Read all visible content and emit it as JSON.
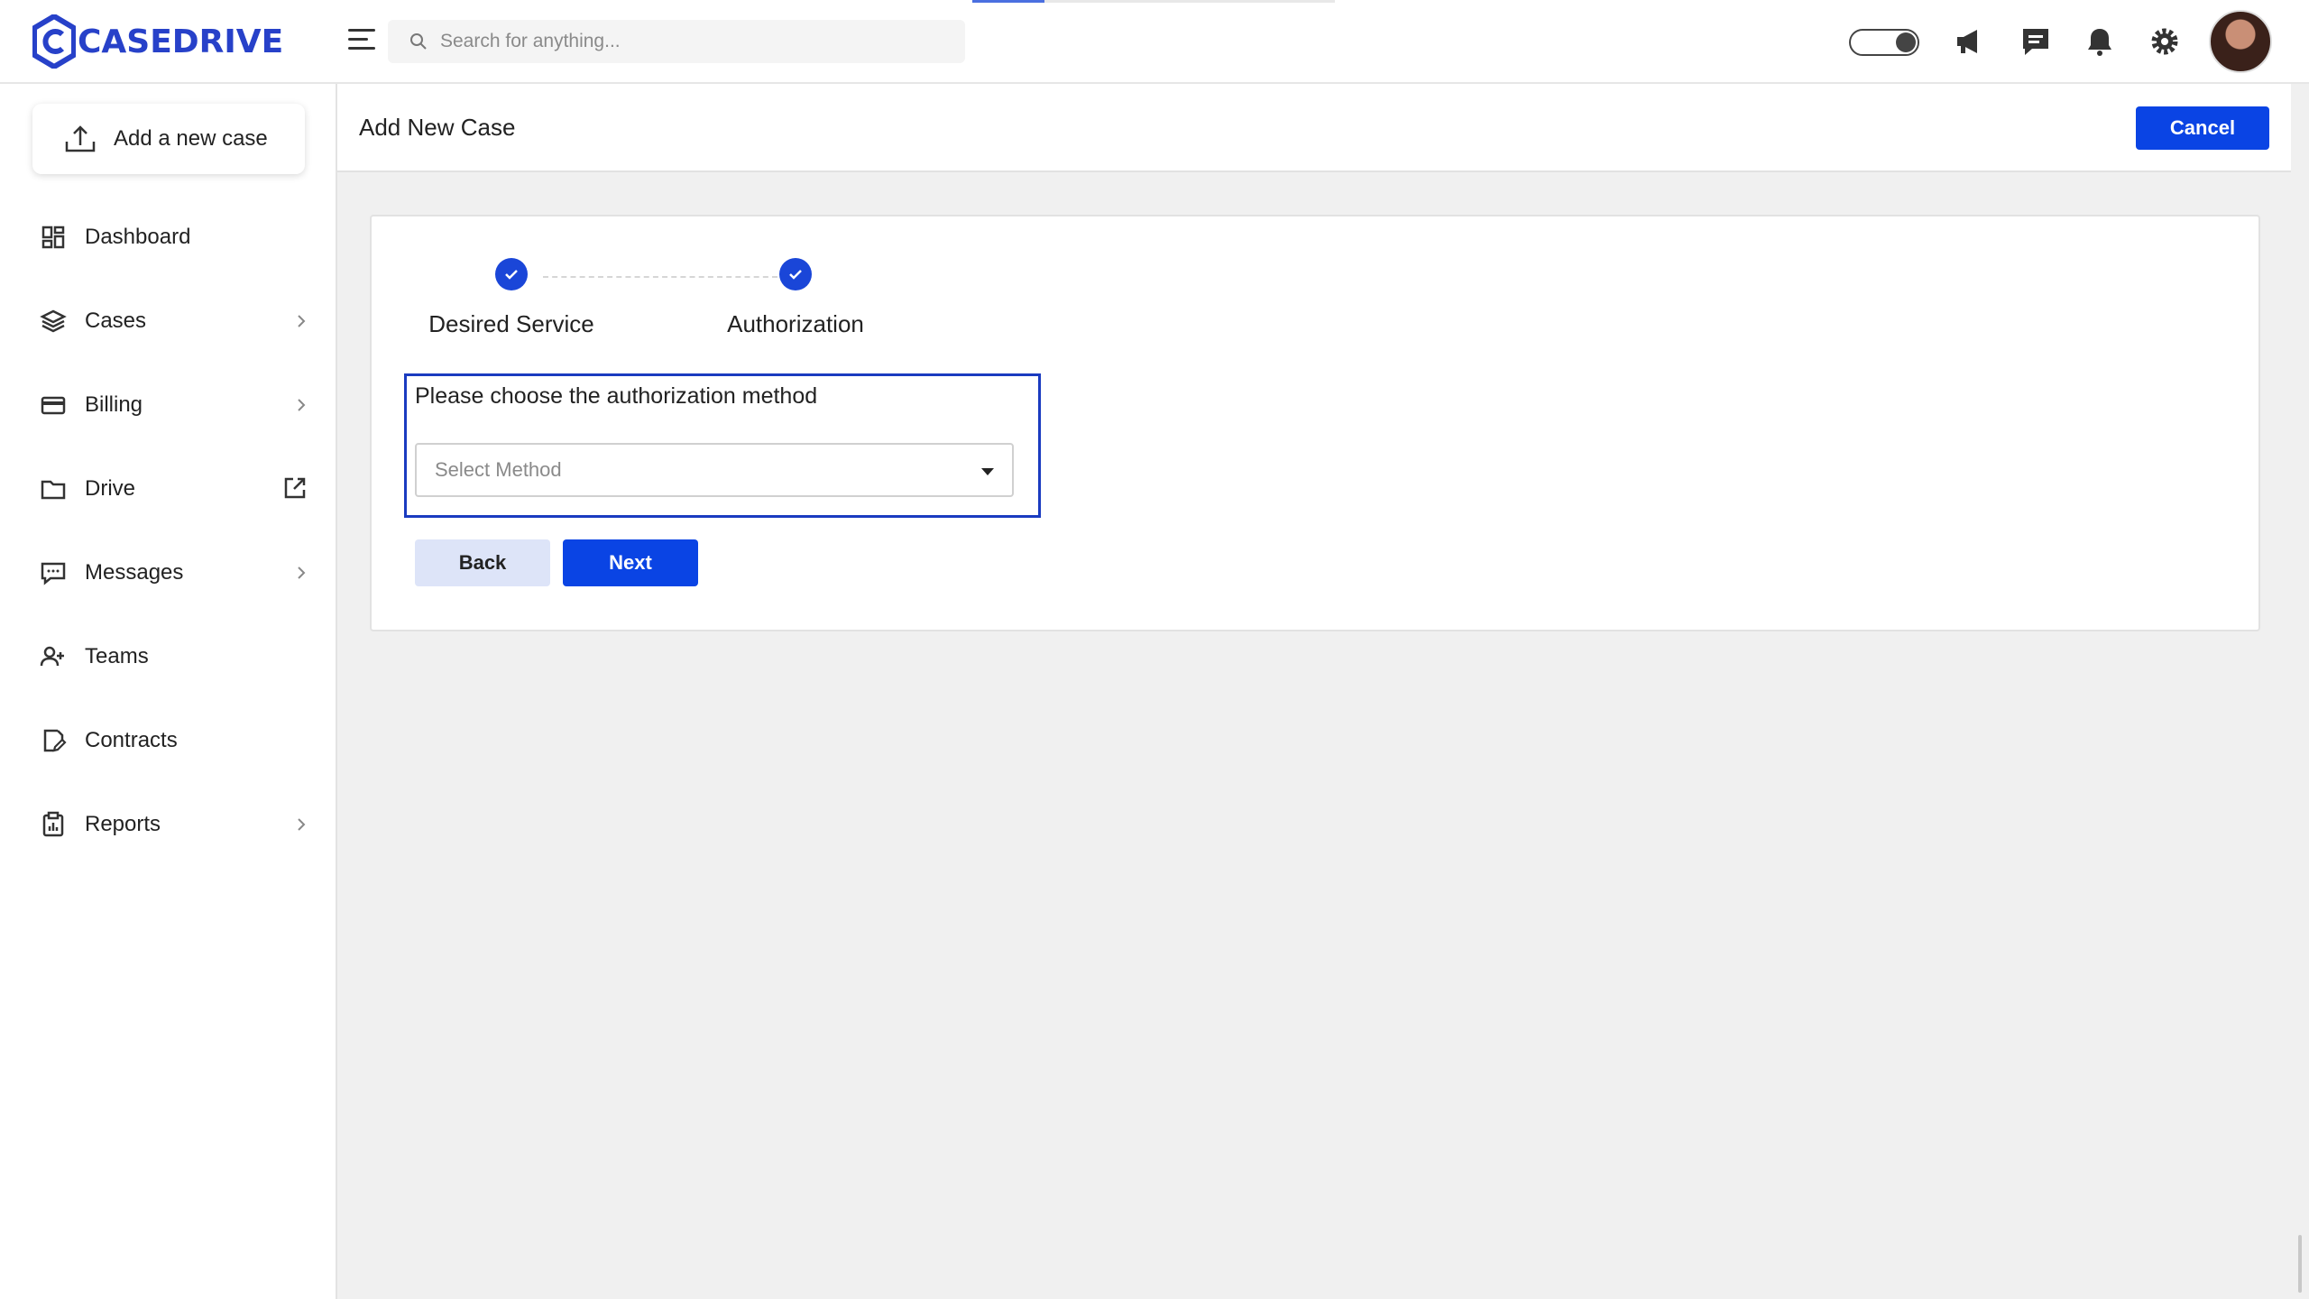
{
  "app": {
    "brand": "CASEDRIVE"
  },
  "header": {
    "search_placeholder": "Search for anything...",
    "icons": [
      "menu-icon",
      "search-icon",
      "theme-toggle",
      "megaphone-icon",
      "chat-icon",
      "bell-icon",
      "gear-icon",
      "avatar"
    ]
  },
  "sidebar": {
    "add_case_label": "Add a new case",
    "items": [
      {
        "label": "Dashboard",
        "icon": "grid-icon",
        "chevron": false
      },
      {
        "label": "Cases",
        "icon": "layers-icon",
        "chevron": true
      },
      {
        "label": "Billing",
        "icon": "card-icon",
        "chevron": true
      },
      {
        "label": "Drive",
        "icon": "folder-icon",
        "external": true
      },
      {
        "label": "Messages",
        "icon": "message-icon",
        "chevron": true
      },
      {
        "label": "Teams",
        "icon": "users-icon",
        "chevron": false
      },
      {
        "label": "Contracts",
        "icon": "contract-icon",
        "chevron": false
      },
      {
        "label": "Reports",
        "icon": "clipboard-icon",
        "chevron": true
      }
    ]
  },
  "page": {
    "title": "Add New Case",
    "cancel_label": "Cancel"
  },
  "wizard": {
    "steps": [
      {
        "label": "Desired Service",
        "completed": true
      },
      {
        "label": "Authorization",
        "completed": true
      }
    ],
    "question": "Please choose the authorization method",
    "select_placeholder": "Select Method",
    "back_label": "Back",
    "next_label": "Next"
  },
  "colors": {
    "brand": "#2741c9",
    "primary_button": "#0a44e4",
    "secondary_button": "#dde4f8",
    "highlight_border": "#1a3bc0"
  }
}
